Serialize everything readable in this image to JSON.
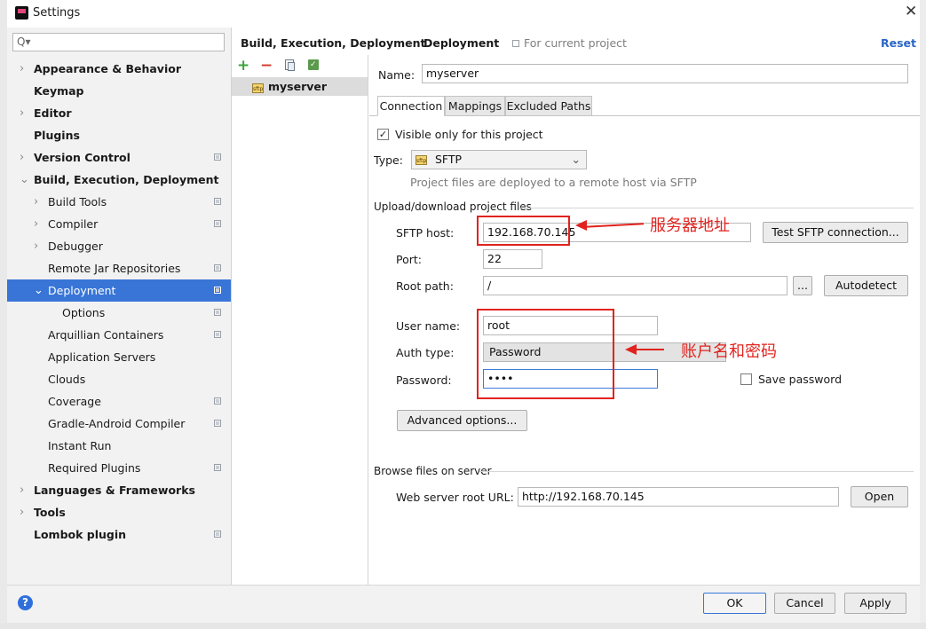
{
  "window": {
    "title": "Settings",
    "close_glyph": "✕"
  },
  "search": {
    "placeholder": "Q▾"
  },
  "sidebar": {
    "items": [
      {
        "label": "Appearance & Behavior",
        "bold": true,
        "arrow": "›",
        "indent": 0
      },
      {
        "label": "Keymap",
        "bold": true,
        "arrow": "",
        "indent": 0
      },
      {
        "label": "Editor",
        "bold": true,
        "arrow": "›",
        "indent": 0
      },
      {
        "label": "Plugins",
        "bold": true,
        "arrow": "",
        "indent": 0
      },
      {
        "label": "Version Control",
        "bold": true,
        "arrow": "›",
        "indent": 0,
        "page_icon": true
      },
      {
        "label": "Build, Execution, Deployment",
        "bold": true,
        "arrow": "⌄",
        "indent": 0
      },
      {
        "label": "Build Tools",
        "bold": false,
        "arrow": "›",
        "indent": 1,
        "page_icon": true
      },
      {
        "label": "Compiler",
        "bold": false,
        "arrow": "›",
        "indent": 1,
        "page_icon": true
      },
      {
        "label": "Debugger",
        "bold": false,
        "arrow": "›",
        "indent": 1
      },
      {
        "label": "Remote Jar Repositories",
        "bold": false,
        "arrow": "",
        "indent": 1,
        "page_icon": true
      },
      {
        "label": "Deployment",
        "bold": false,
        "arrow": "⌄",
        "indent": 1,
        "page_icon": true,
        "selected": true
      },
      {
        "label": "Options",
        "bold": false,
        "arrow": "",
        "indent": 2,
        "page_icon": true
      },
      {
        "label": "Arquillian Containers",
        "bold": false,
        "arrow": "",
        "indent": 1,
        "page_icon": true
      },
      {
        "label": "Application Servers",
        "bold": false,
        "arrow": "",
        "indent": 1
      },
      {
        "label": "Clouds",
        "bold": false,
        "arrow": "",
        "indent": 1
      },
      {
        "label": "Coverage",
        "bold": false,
        "arrow": "",
        "indent": 1,
        "page_icon": true
      },
      {
        "label": "Gradle-Android Compiler",
        "bold": false,
        "arrow": "",
        "indent": 1,
        "page_icon": true
      },
      {
        "label": "Instant Run",
        "bold": false,
        "arrow": "",
        "indent": 1
      },
      {
        "label": "Required Plugins",
        "bold": false,
        "arrow": "",
        "indent": 1,
        "page_icon": true
      },
      {
        "label": "Languages & Frameworks",
        "bold": true,
        "arrow": "›",
        "indent": 0
      },
      {
        "label": "Tools",
        "bold": true,
        "arrow": "›",
        "indent": 0
      },
      {
        "label": "Lombok plugin",
        "bold": true,
        "arrow": "",
        "indent": 0,
        "page_icon": true
      }
    ]
  },
  "breadcrumb": {
    "parent": "Build, Execution, Deployment",
    "separator": "›",
    "current": "Deployment",
    "scope": "For current project",
    "reset": "Reset"
  },
  "toolbar": {
    "add": "+",
    "remove": "−"
  },
  "servers": [
    {
      "name": "myserver",
      "icon_text": "sftp"
    }
  ],
  "form": {
    "name_label": "Name:",
    "name_value": "myserver",
    "tabs": [
      "Connection",
      "Mappings",
      "Excluded Paths"
    ],
    "visible_only_label": "Visible only for this project",
    "visible_only_checked": "✓",
    "type_label": "Type:",
    "type_value": "SFTP",
    "type_hint": "Project files are deployed to a remote host via SFTP",
    "upload_section": "Upload/download project files",
    "host_label": "SFTP host:",
    "host_value": "192.168.70.145",
    "test_button": "Test SFTP connection...",
    "port_label": "Port:",
    "port_value": "22",
    "root_path_label": "Root path:",
    "root_path_value": "/",
    "browse_button": "...",
    "autodetect_button": "Autodetect",
    "user_label": "User name:",
    "user_value": "root",
    "auth_label": "Auth type:",
    "auth_value": "Password",
    "password_label": "Password:",
    "password_value": "••••",
    "save_password_label": "Save password",
    "advanced_button": "Advanced options...",
    "browse_section": "Browse files on server",
    "web_root_label": "Web server root URL:",
    "web_root_value": "http://192.168.70.145",
    "open_button": "Open"
  },
  "annotations": {
    "host_note": "服务器地址",
    "account_note": "账户名和密码",
    "color": "#e1231e"
  },
  "footer": {
    "help": "?",
    "ok": "OK",
    "cancel": "Cancel",
    "apply": "Apply"
  }
}
